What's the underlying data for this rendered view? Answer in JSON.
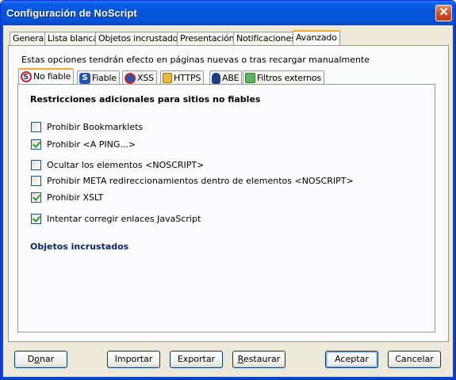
{
  "window": {
    "title": "Configuración de NoScript",
    "close_glyph": "✕"
  },
  "tabs": [
    {
      "label": "General",
      "active": false
    },
    {
      "label": "Lista blanca",
      "active": false
    },
    {
      "label": "Objetos incrustados",
      "active": false
    },
    {
      "label": "Presentación",
      "active": false
    },
    {
      "label": "Notificaciones",
      "active": false
    },
    {
      "label": "Avanzado",
      "active": true
    }
  ],
  "info": "Estas opciones tendrán efecto en páginas nuevas o tras recargar manualmente",
  "subtabs": [
    {
      "label": "No fiable",
      "icon": "noscript-icon",
      "active": true
    },
    {
      "label": "Fiable",
      "icon": "s-icon",
      "active": false
    },
    {
      "label": "XSS",
      "icon": "xss-icon",
      "active": false
    },
    {
      "label": "HTTPS",
      "icon": "lock-icon",
      "active": false
    },
    {
      "label": "ABE",
      "icon": "abe-icon",
      "active": false
    },
    {
      "label": "Filtros externos",
      "icon": "puzzle-icon",
      "active": false
    }
  ],
  "section": {
    "title": "Restricciones adicionales para sitios no fiables",
    "options": [
      {
        "label": "Prohibir Bookmarklets",
        "checked": false
      },
      {
        "label": "Prohibir <A PING...>",
        "checked": true
      },
      {
        "label": "Ocultar los elementos <NOSCRIPT>",
        "checked": false
      },
      {
        "label": "Prohibir META redireccionamientos dentro de elementos <NOSCRIPT>",
        "checked": false
      },
      {
        "label": "Prohibir XSLT",
        "checked": true
      },
      {
        "label": "Intentar corregir enlaces JavaScript",
        "checked": true
      }
    ],
    "subsection_title": "Objetos incrustados"
  },
  "buttons": {
    "donate": {
      "first": "D",
      "accel": "o",
      "rest": "nar"
    },
    "import": "Importar",
    "export": "Exportar",
    "restore": {
      "accel": "R",
      "rest": "estaurar"
    },
    "accept": "Aceptar",
    "cancel": "Cancelar"
  }
}
